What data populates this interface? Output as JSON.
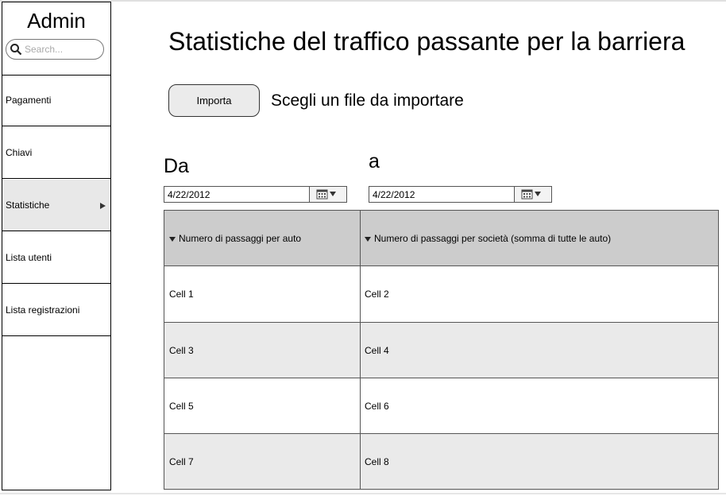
{
  "sidebar": {
    "title": "Admin",
    "search_placeholder": "Search...",
    "items": [
      {
        "label": "Pagamenti",
        "active": false
      },
      {
        "label": "Chiavi",
        "active": false
      },
      {
        "label": "Statistiche",
        "active": true
      },
      {
        "label": "Lista utenti",
        "active": false
      },
      {
        "label": "Lista registrazioni",
        "active": false
      }
    ]
  },
  "main": {
    "title": "Statistiche del traffico passante per la barriera",
    "import_button": "Importa",
    "file_label": "Scegli un file da importare",
    "from_label": "Da",
    "to_label": "a",
    "from_date": "4/22/2012",
    "to_date": "4/22/2012",
    "table": {
      "headers": [
        "Numero di passaggi per auto",
        "Numero di passaggi per società (somma di tutte le auto)"
      ],
      "rows": [
        [
          "Cell 1",
          "Cell 2"
        ],
        [
          "Cell 3",
          "Cell 4"
        ],
        [
          "Cell 5",
          "Cell 6"
        ],
        [
          "Cell 7",
          "Cell 8"
        ]
      ]
    }
  },
  "icons": {
    "search": "search-icon",
    "calendar": "calendar-icon",
    "sort": "sort-arrow-icon",
    "submenu": "chevron-right-icon"
  }
}
